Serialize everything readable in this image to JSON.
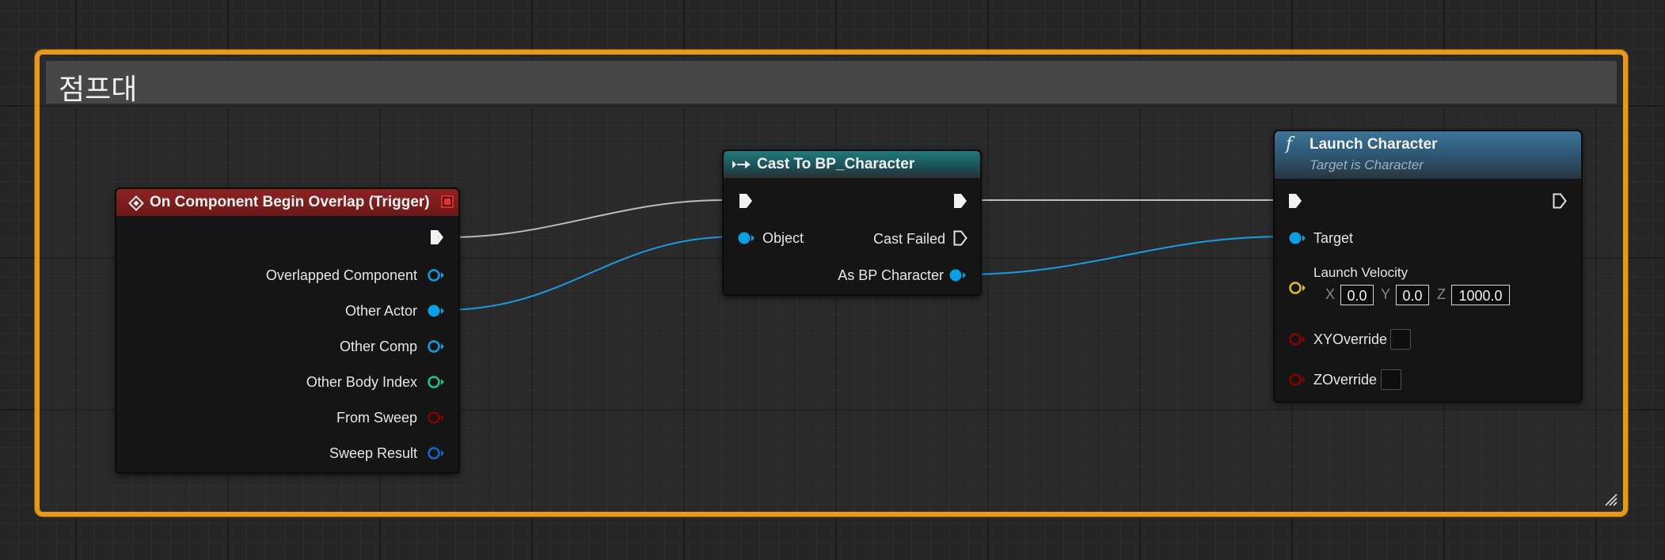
{
  "comment": {
    "title": "점프대"
  },
  "colors": {
    "comment_border": "#e6991c",
    "event_header": "#8b1d1d",
    "cast_header": "#1a6a6a",
    "function_header": "#3a6d8c",
    "object_pin": "#0aa0e6",
    "struct_pin": "#0a6ad6",
    "int_pin": "#1cc38a",
    "bool_pin": "#8b0000",
    "vector_pin": "#e0c020",
    "exec_wire": "#d0d0d0"
  },
  "event_node": {
    "title": "On Component Begin Overlap (Trigger)",
    "header_icon": "event-diamond-icon",
    "outputs": [
      {
        "label": "Overlapped Component",
        "type": "object-hollow"
      },
      {
        "label": "Other Actor",
        "type": "object-connected"
      },
      {
        "label": "Other Comp",
        "type": "object-hollow"
      },
      {
        "label": "Other Body Index",
        "type": "int-hollow"
      },
      {
        "label": "From Sweep",
        "type": "bool-hollow"
      },
      {
        "label": "Sweep Result",
        "type": "struct-hollow"
      }
    ]
  },
  "cast_node": {
    "title": "Cast To BP_Character",
    "header_icon": "cast-arrows-icon",
    "input_object": "Object",
    "cast_failed": "Cast Failed",
    "output_object": "As BP Character"
  },
  "launch_node": {
    "title": "Launch Character",
    "subtitle": "Target is Character",
    "header_icon": "function-f-icon",
    "function_glyph": "f",
    "target": "Target",
    "launch_velocity": {
      "label": "Launch Velocity",
      "x_label": "X",
      "x": "0.0",
      "y_label": "Y",
      "y": "0.0",
      "z_label": "Z",
      "z": "1000.0"
    },
    "xy_override": "XYOverride",
    "z_override": "ZOverride"
  }
}
